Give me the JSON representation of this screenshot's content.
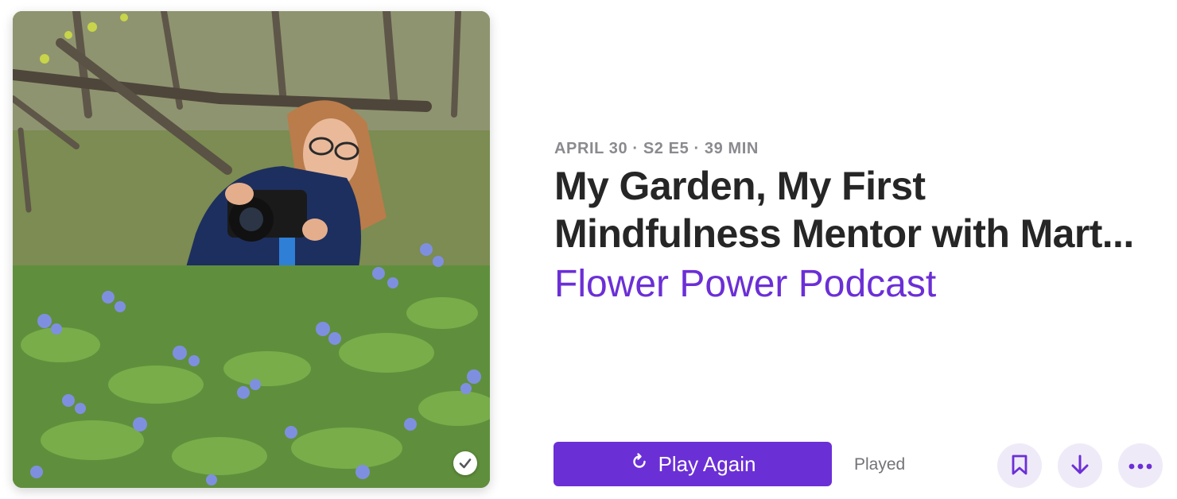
{
  "episode": {
    "meta": "APRIL 30 · S2 E5 · 39 MIN",
    "title_line1": "My Garden, My First",
    "title_line2": "Mindfulness Mentor with Mart...",
    "podcast_name": "Flower Power Podcast",
    "artwork_alt": "Woman photographing bluebell flowers in a wooded meadow"
  },
  "actions": {
    "play_again_label": "Play Again",
    "status_label": "Played",
    "bookmark_icon": "bookmark-icon",
    "download_icon": "arrow-down-icon",
    "more_icon": "ellipsis-icon",
    "replay_icon": "replay-icon",
    "played_check_icon": "checkmark-icon"
  },
  "colors": {
    "accent": "#6b2fd6",
    "accent_soft": "#efeaf8",
    "title": "#262626",
    "meta": "#8a8a8f"
  }
}
